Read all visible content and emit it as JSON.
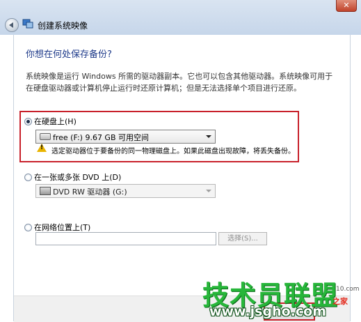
{
  "window": {
    "title": "创建系统映像",
    "close_glyph": "✕"
  },
  "main": {
    "heading": "你想在何处保存备份?",
    "description": "系统映像是运行 Windows 所需的驱动器副本。它也可以包含其他驱动器。系统映像可用于在硬盘驱动器或计算机停止运行时还原计算机；但是无法选择单个项目进行还原。"
  },
  "options": {
    "hard_disk": {
      "label": "在硬盘上(H)",
      "selected": true,
      "drive_value": "free (F:)  9.67 GB 可用空间",
      "warning": "选定驱动器位于要备份的同一物理磁盘上。如果此磁盘出现故障，将丢失备份。"
    },
    "dvd": {
      "label": "在一张或多张 DVD 上(D)",
      "selected": false,
      "drive_value": "DVD RW 驱动器 (G:)"
    },
    "network": {
      "label": "在网络位置上(T)",
      "selected": false,
      "path_value": "",
      "choose_label": "选择(S)..."
    }
  },
  "watermark": {
    "main": "技术员联盟",
    "url": "www.jsgho.com",
    "corner": "之家",
    "small": "10.com"
  },
  "icons": [
    "back-arrow-icon",
    "system-image-icon",
    "hard-drive-icon",
    "dvd-drive-icon",
    "warning-icon"
  ]
}
